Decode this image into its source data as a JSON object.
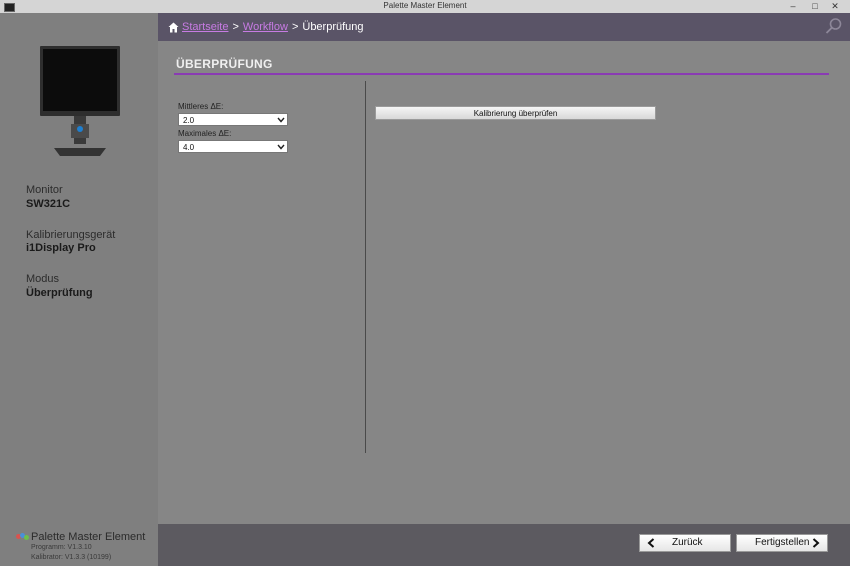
{
  "window": {
    "title": "Palette Master Element"
  },
  "sidebar": {
    "monitor_label": "Monitor",
    "monitor_value": "SW321C",
    "device_label": "Kalibrierungsgerät",
    "device_value": "i1Display Pro",
    "mode_label": "Modus",
    "mode_value": "Überprüfung",
    "brand": "Palette Master Element",
    "program_version": "Programm: V1.3.10",
    "calibrator_version": "Kalibrator: V1.3.3 (10199)"
  },
  "breadcrumb": {
    "home": "Startseite",
    "workflow": "Workflow",
    "current": "Überprüfung",
    "separator": ">"
  },
  "main": {
    "section_title": "ÜBERPRÜFUNG",
    "avg_label": "Mittleres ΔE:",
    "avg_value": "2.0",
    "max_label": "Maximales ΔE:",
    "max_value": "4.0",
    "verify_button": "Kalibrierung überprüfen"
  },
  "footer": {
    "back_label": "Zurück",
    "finish_label": "Fertigstellen"
  },
  "colors": {
    "accent": "#8a3bb4",
    "link": "#c77be3",
    "topbar": "#5a5467"
  }
}
